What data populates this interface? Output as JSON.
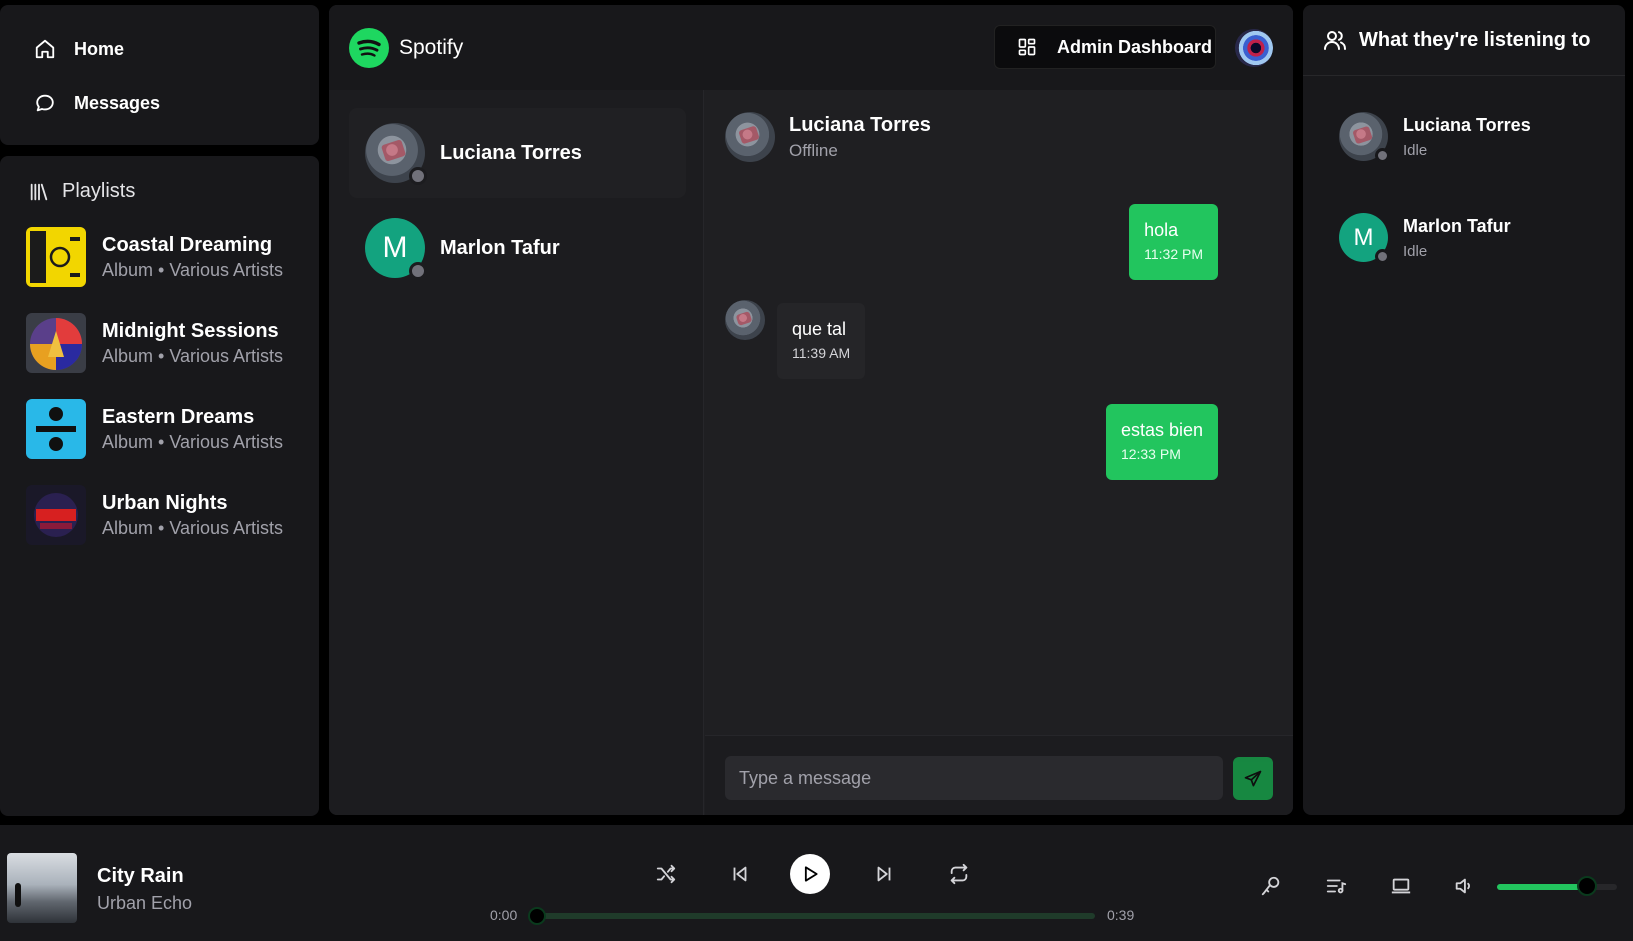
{
  "nav": {
    "home_label": "Home",
    "messages_label": "Messages"
  },
  "playlists": {
    "heading": "Playlists",
    "items": [
      {
        "title": "Coastal Dreaming",
        "subtitle": "Album • Various Artists",
        "cover_colors": [
          "#f2d600",
          "#1b1b1b"
        ]
      },
      {
        "title": "Midnight Sessions",
        "subtitle": "Album • Various Artists",
        "cover_colors": [
          "#e23c3c",
          "#2a2aa0"
        ]
      },
      {
        "title": "Eastern Dreams",
        "subtitle": "Album • Various Artists",
        "cover_colors": [
          "#29b8e8",
          "#101010"
        ]
      },
      {
        "title": "Urban Nights",
        "subtitle": "Album • Various Artists",
        "cover_colors": [
          "#d72020",
          "#2a2050"
        ]
      }
    ]
  },
  "topbar": {
    "brand": "Spotify",
    "admin_label": "Admin Dashboard"
  },
  "contacts": [
    {
      "name": "Luciana Torres",
      "initial": "",
      "active": true
    },
    {
      "name": "Marlon Tafur",
      "initial": "M",
      "active": false
    }
  ],
  "chat": {
    "name": "Luciana Torres",
    "status": "Offline",
    "messages": [
      {
        "direction": "out",
        "text": "hola",
        "time": "11:32 PM"
      },
      {
        "direction": "in",
        "text": "que tal",
        "time": "11:39 AM"
      },
      {
        "direction": "out",
        "text": "estas bien",
        "time": "12:33 PM"
      }
    ],
    "placeholder": "Type a message"
  },
  "activity": {
    "heading": "What they're listening to",
    "friends": [
      {
        "name": "Luciana Torres",
        "initial": "",
        "status": "Idle"
      },
      {
        "name": "Marlon Tafur",
        "initial": "M",
        "status": "Idle"
      }
    ]
  },
  "player": {
    "title": "City Rain",
    "artist": "Urban Echo",
    "elapsed": "0:00",
    "duration": "0:39",
    "progress": 0,
    "volume": 0.75
  },
  "colors": {
    "accent": "#22c55e",
    "panel": "#18181b",
    "background": "#000000",
    "avatar_letter_bg": "#13a37f"
  }
}
